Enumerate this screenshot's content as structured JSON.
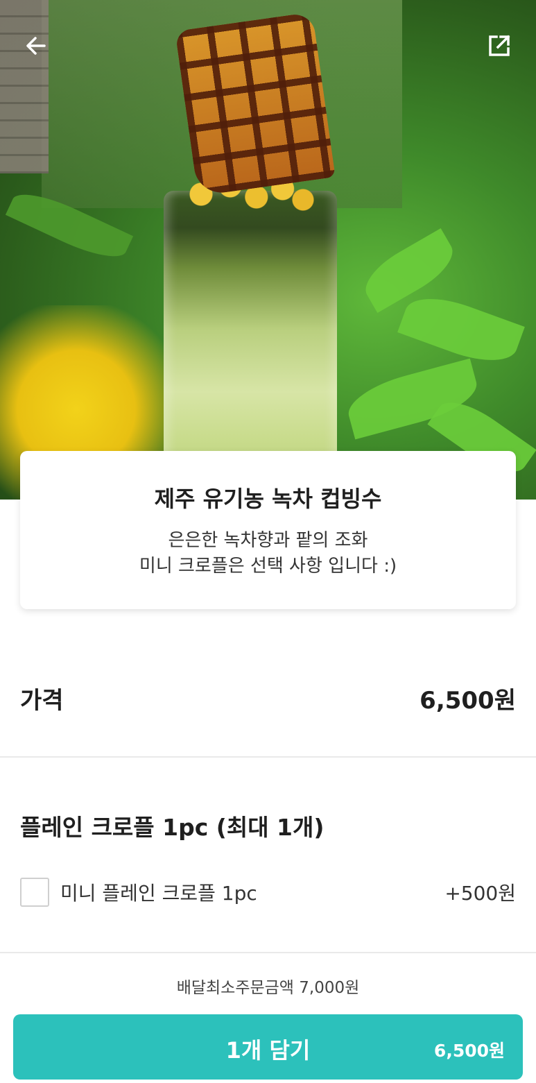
{
  "header": {
    "back_icon": "arrow-left-icon",
    "share_icon": "share-external-icon"
  },
  "product": {
    "name": "제주 유기농 녹차 컵빙수",
    "description_line1": "은은한 녹차향과 팥의 조화",
    "description_line2": "미니 크로플은 선택 사항 입니다 :)",
    "image": "photo of green tea cup bingsu topped with waffle croffle"
  },
  "price": {
    "label": "가격",
    "value": "6,500원"
  },
  "options": {
    "group_title": "플레인 크로플 1pc (최대 1개)",
    "items": [
      {
        "label": "미니 플레인 크로플 1pc",
        "price": "+500원",
        "checked": false
      }
    ]
  },
  "footer": {
    "min_order": "배달최소주문금액 7,000원",
    "cart_button_label": "1개 담기",
    "cart_button_price": "6,500원",
    "accent_color": "#2cc1bb"
  }
}
